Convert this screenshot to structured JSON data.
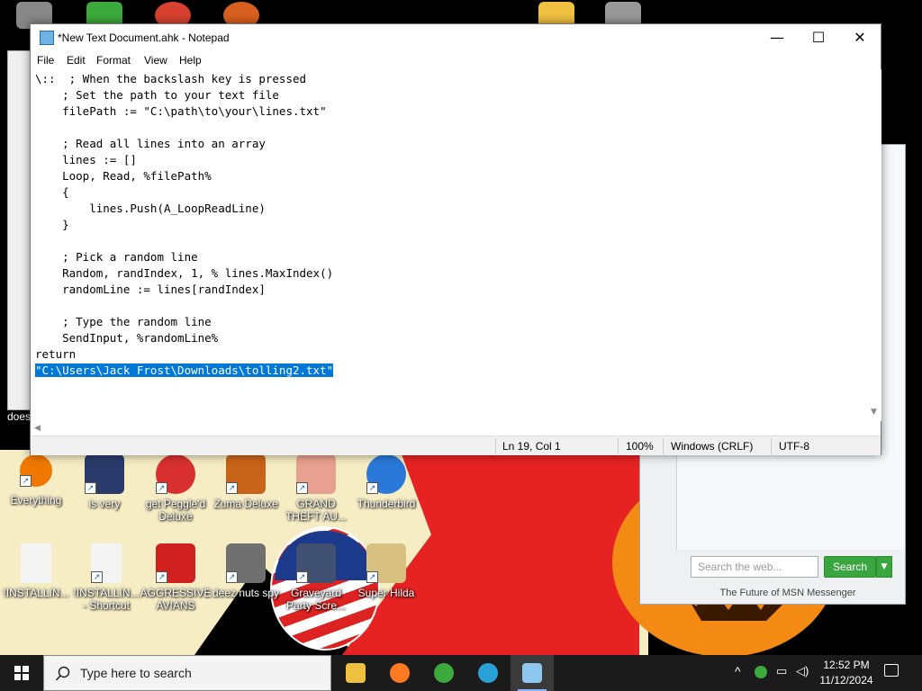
{
  "notepad": {
    "title": "*New Text Document.ahk - Notepad",
    "controls": {
      "minimize": "—",
      "maximize": "☐",
      "close": "✕"
    },
    "menu": [
      "File",
      "Edit",
      "Format",
      "View",
      "Help"
    ],
    "lines": [
      "\\::  ; When the backslash key is pressed",
      "    ; Set the path to your text file",
      "    filePath := \"C:\\path\\to\\your\\lines.txt\"",
      "",
      "    ; Read all lines into an array",
      "    lines := []",
      "    Loop, Read, %filePath%",
      "    {",
      "        lines.Push(A_LoopReadLine)",
      "    }",
      "",
      "    ; Pick a random line",
      "    Random, randIndex, 1, % lines.MaxIndex()",
      "    randomLine := lines[randIndex]",
      "",
      "    ; Type the random line",
      "    SendInput, %randomLine%",
      "return"
    ],
    "selected_line": "\"C:\\Users\\Jack Frost\\Downloads\\tolling2.txt\"",
    "status": {
      "position": "Ln 19, Col 1",
      "zoom": "100%",
      "line_ending": "Windows (CRLF)",
      "encoding": "UTF-8"
    }
  },
  "desktop_icons": [
    {
      "label": "Everything",
      "icon": "everything-icon",
      "color": "#f07800"
    },
    {
      "label": "is very",
      "icon": "shortcut-icon",
      "color": "#2a3a6a"
    },
    {
      "label": "get Peggle'd Deluxe",
      "icon": "peggle-icon",
      "color": "#d83030"
    },
    {
      "label": "Zuma Deluxe",
      "icon": "zuma-icon",
      "color": "#c8641a"
    },
    {
      "label": "GRAND THEFT AU...",
      "icon": "gta-icon",
      "color": "#e8a090"
    },
    {
      "label": "Thunderbird",
      "icon": "thunderbird-icon",
      "color": "#2a78d8"
    },
    {
      "label": "!INSTALLIN...",
      "icon": "text-file-icon",
      "color": "#f4f4f4"
    },
    {
      "label": "!INSTALLIN... - Shortcut",
      "icon": "text-file-shortcut-icon",
      "color": "#f4f4f4"
    },
    {
      "label": "AGGRESSIVE AVIANS",
      "icon": "angry-birds-icon",
      "color": "#d02020"
    },
    {
      "label": "deez nuts spy",
      "icon": "windows-stack-icon",
      "color": "#707070"
    },
    {
      "label": "Graveyard Party Scre...",
      "icon": "graveyard-icon",
      "color": "#405070"
    },
    {
      "label": "Super Hilda",
      "icon": "super-hilda-icon",
      "color": "#d8c080"
    }
  ],
  "left_window": {
    "label": "does"
  },
  "msn": {
    "search_placeholder": "Search the web...",
    "search_button": "Search",
    "tagline": "The Future of MSN Messenger"
  },
  "taskbar": {
    "search_placeholder": "Type here to search",
    "apps": [
      {
        "name": "file-explorer",
        "icon": "folder-icon",
        "color": "#f0c040"
      },
      {
        "name": "firefox",
        "icon": "firefox-icon",
        "color": "#ff7a20"
      },
      {
        "name": "messenger",
        "icon": "messenger-icon",
        "color": "#3caa3c"
      },
      {
        "name": "edge",
        "icon": "edge-icon",
        "color": "#2aa0d8"
      },
      {
        "name": "notepad",
        "icon": "notepad-icon",
        "color": "#8ec8f0"
      }
    ],
    "clock_time": "12:52 PM",
    "clock_date": "11/12/2024"
  },
  "colors": {
    "selection": "#0078d7",
    "taskbar": "#1b1b1b",
    "msn_search": "#3aa640"
  }
}
